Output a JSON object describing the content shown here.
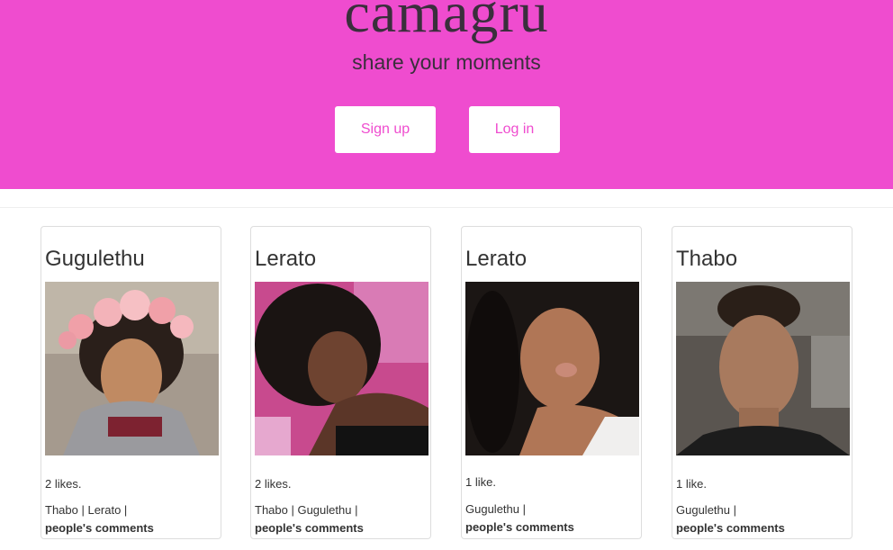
{
  "header": {
    "brand": "camagru",
    "tagline": "share your moments",
    "signup_label": "Sign up",
    "login_label": "Log in"
  },
  "colors": {
    "accent": "#ef4ccf",
    "text": "#3a2f3c"
  },
  "posts": [
    {
      "author": "Gugulethu",
      "likes": "2 likes.",
      "commenters": "Thabo | Lerato |",
      "comments_label": "people's comments"
    },
    {
      "author": "Lerato",
      "likes": "2 likes.",
      "commenters": "Thabo | Gugulethu |",
      "comments_label": "people's comments"
    },
    {
      "author": "Lerato",
      "likes": "1 like.",
      "commenters": "Gugulethu |",
      "comments_label": "people's comments"
    },
    {
      "author": "Thabo",
      "likes": "1 like.",
      "commenters": "Gugulethu |",
      "comments_label": "people's comments"
    }
  ]
}
